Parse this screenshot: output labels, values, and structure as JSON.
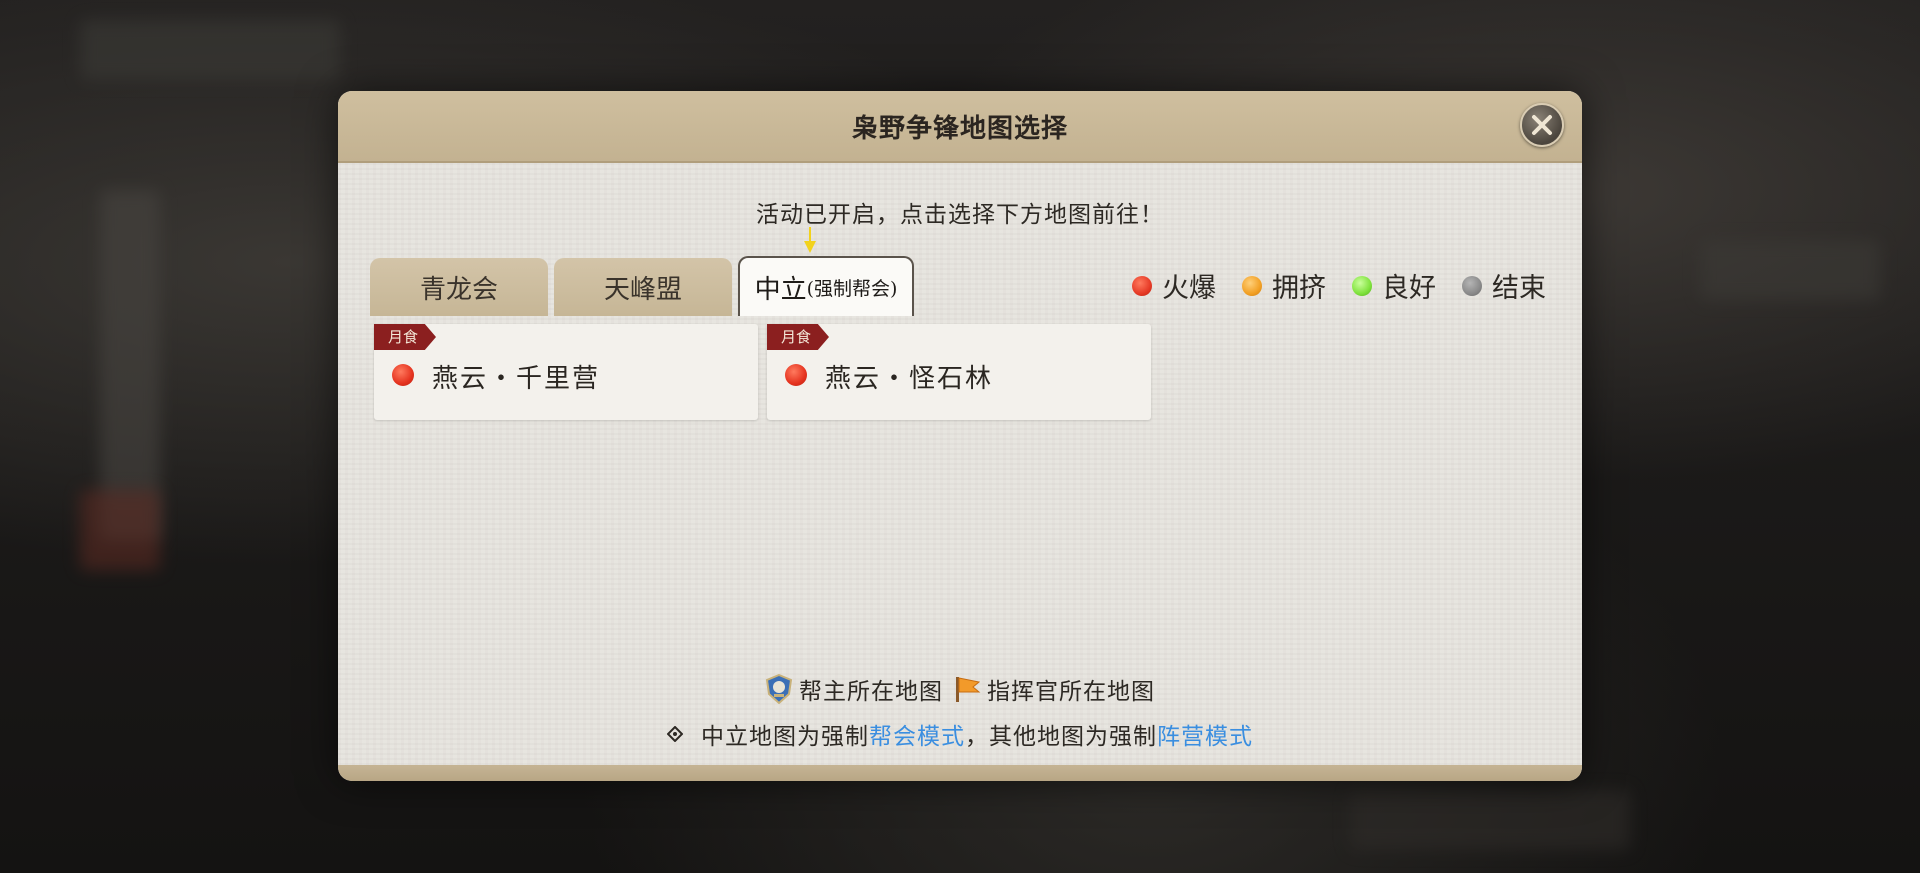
{
  "dialog": {
    "title": "枭野争锋地图选择",
    "notice": "活动已开启，点击选择下方地图前往！"
  },
  "tabs": [
    {
      "label": "青龙会",
      "sub": "",
      "active": false
    },
    {
      "label": "天峰盟",
      "sub": "",
      "active": false
    },
    {
      "label": "中立",
      "sub": "(强制帮会)",
      "active": true
    }
  ],
  "legend": [
    {
      "label": "火爆",
      "color": "#e63a26"
    },
    {
      "label": "拥挤",
      "color": "#f2a024"
    },
    {
      "label": "良好",
      "color": "#7fe23c"
    },
    {
      "label": "结束",
      "color": "#8a8a8a"
    }
  ],
  "maps": [
    {
      "tag": "月食",
      "name": "燕云・千里营",
      "status_color": "#e63a26"
    },
    {
      "tag": "月食",
      "name": "燕云・怪石林",
      "status_color": "#e63a26"
    }
  ],
  "footer": {
    "leader_label": "帮主所在地图",
    "commander_label": "指挥官所在地图",
    "note_prefix": "中立地图为强制",
    "note_link1": "帮会模式",
    "note_middle": "，其他地图为强制",
    "note_link2": "阵营模式"
  },
  "colors": {
    "link": "#3a8ee0",
    "tag_bg": "#8b1f1f"
  },
  "icons": {
    "close": "close-icon",
    "leader": "guild-leader-badge-icon",
    "commander": "commander-flag-icon",
    "note": "diamond-bullet-icon"
  }
}
